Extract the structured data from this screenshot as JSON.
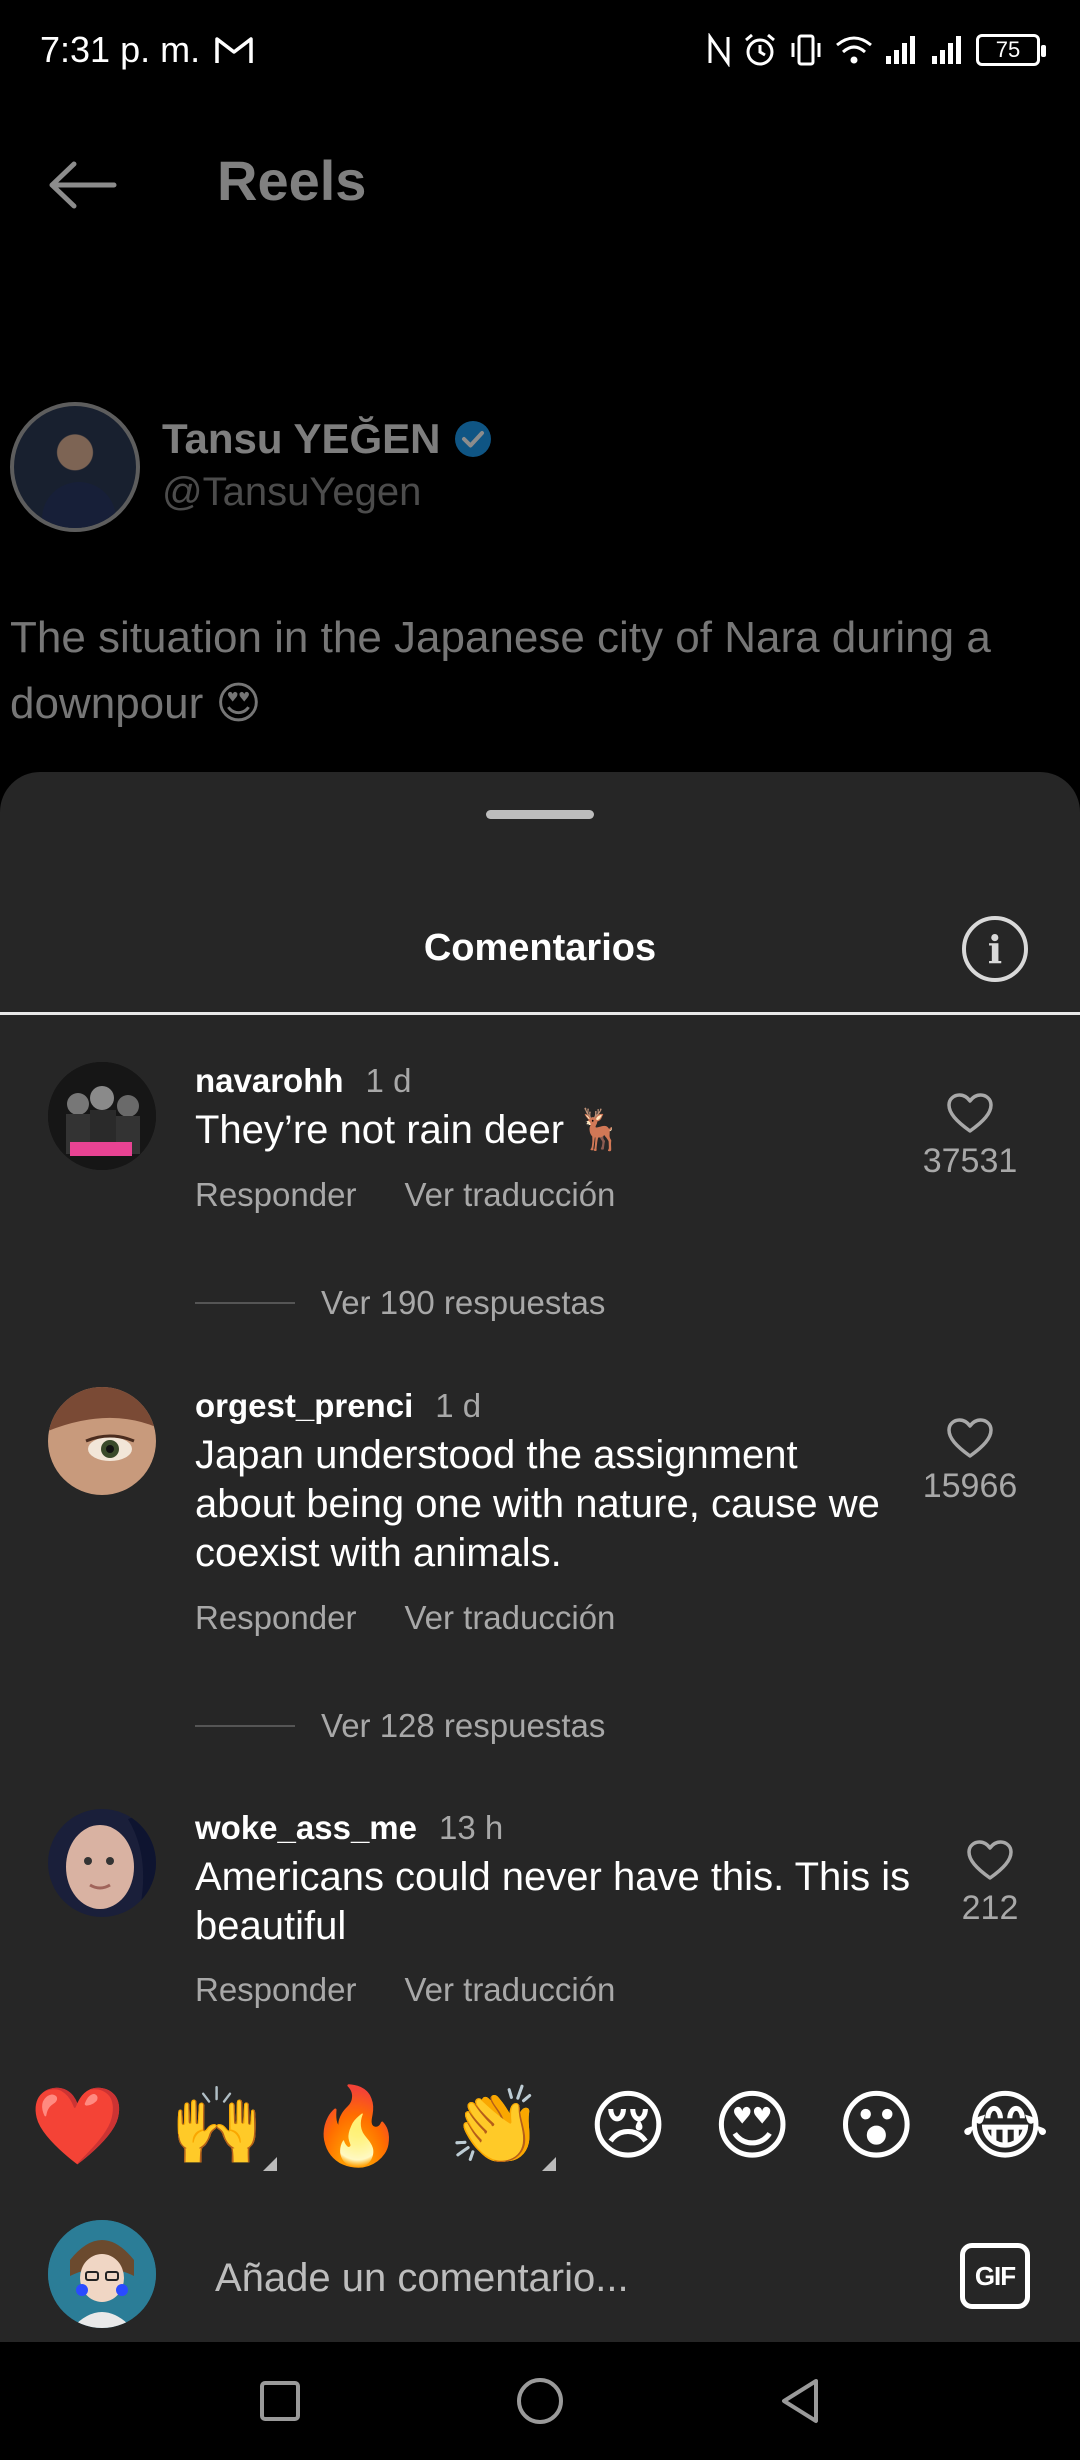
{
  "status_bar": {
    "time": "7:31 p. m.",
    "battery": "75",
    "icons": [
      "gmail-icon",
      "nfc-icon",
      "alarm-icon",
      "vibrate-icon",
      "wifi-icon",
      "signal-icon",
      "signal-icon",
      "battery-icon"
    ]
  },
  "header": {
    "title": "Reels",
    "back_icon": "arrow-left-icon"
  },
  "tweet": {
    "name": "Tansu YEĞEN",
    "handle": "@TansuYegen",
    "text": "The situation in the Japanese city of Nara during a downpour 😍"
  },
  "comments_sheet": {
    "title": "Comentarios",
    "info_symbol": "i",
    "colors": {
      "background": "#262626",
      "muted": "#a8a8a8"
    },
    "comments": [
      {
        "user": "navarohh",
        "time": "1 d",
        "text": "They’re not rain deer 🦌",
        "reply_label": "Responder",
        "translate_label": "Ver traducción",
        "likes": "37531",
        "replies_label": "Ver 190 respuestas"
      },
      {
        "user": "orgest_prenci",
        "time": "1 d",
        "text": "Japan understood the assignment about being one with nature, cause we coexist with animals.",
        "reply_label": "Responder",
        "translate_label": "Ver traducción",
        "likes": "15966",
        "replies_label": "Ver 128 respuestas"
      },
      {
        "user": "woke_ass_me",
        "time": "13 h",
        "text": "Americans could never have this. This is beautiful",
        "reply_label": "Responder",
        "translate_label": "Ver traducción",
        "likes": "212"
      }
    ],
    "quick_reactions": [
      "❤️",
      "🙌",
      "🔥",
      "👏",
      "😢",
      "😍",
      "😮",
      "😂"
    ],
    "input": {
      "placeholder": "Añade un comentario...",
      "gif_label": "GIF"
    }
  },
  "nav_bar": {
    "icons": [
      "recents-square-icon",
      "home-circle-icon",
      "back-triangle-icon"
    ]
  }
}
